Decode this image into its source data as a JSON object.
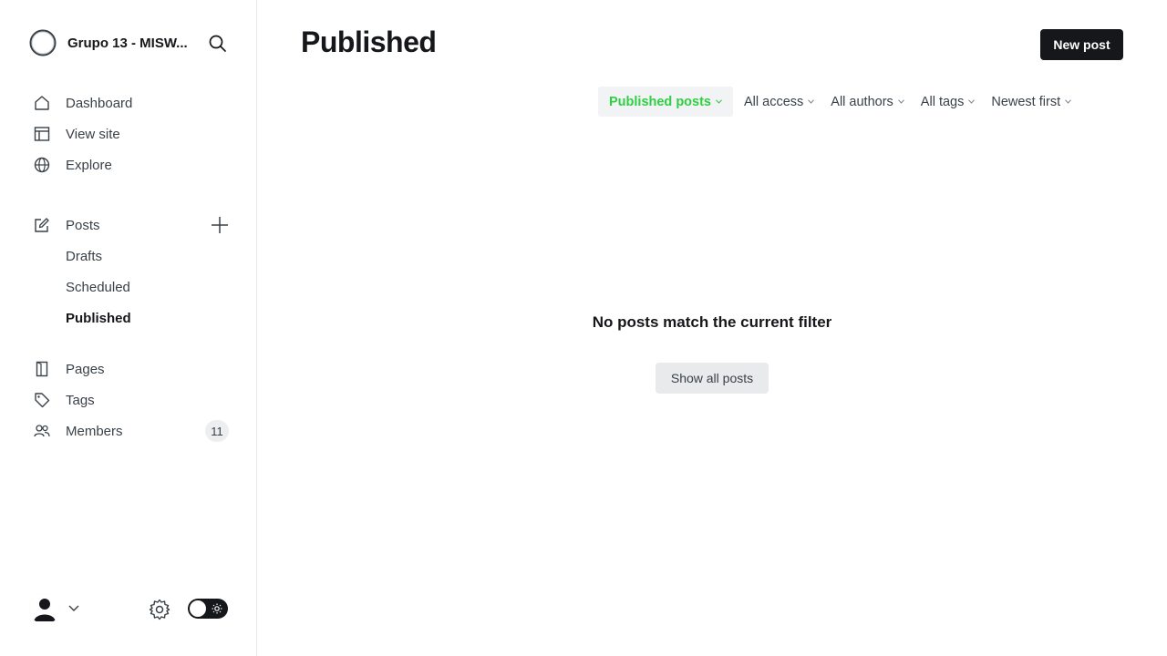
{
  "sidebar": {
    "site_title": "Grupo 13 - MISW...",
    "nav": [
      {
        "label": "Dashboard",
        "icon": "home-icon"
      },
      {
        "label": "View site",
        "icon": "layout-icon"
      },
      {
        "label": "Explore",
        "icon": "globe-icon"
      }
    ],
    "posts": {
      "label": "Posts",
      "icon": "edit-icon",
      "sub": [
        {
          "label": "Drafts",
          "active": false
        },
        {
          "label": "Scheduled",
          "active": false
        },
        {
          "label": "Published",
          "active": true
        }
      ]
    },
    "content": [
      {
        "label": "Pages",
        "icon": "page-icon"
      },
      {
        "label": "Tags",
        "icon": "tag-icon"
      },
      {
        "label": "Members",
        "icon": "members-icon",
        "count": "11"
      }
    ]
  },
  "header": {
    "title": "Published",
    "new_post_label": "New post"
  },
  "filters": [
    {
      "label": "Published posts",
      "active": true
    },
    {
      "label": "All access",
      "active": false
    },
    {
      "label": "All authors",
      "active": false
    },
    {
      "label": "All tags",
      "active": false
    },
    {
      "label": "Newest first",
      "active": false
    }
  ],
  "empty_state": {
    "message": "No posts match the current filter",
    "button_label": "Show all posts"
  },
  "colors": {
    "accent_green": "#30cf43",
    "primary_dark": "#15171a"
  }
}
